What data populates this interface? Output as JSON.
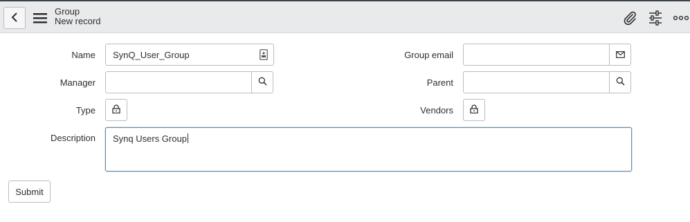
{
  "header": {
    "title": "Group",
    "subtitle": "New record",
    "icons": {
      "back": "chevron-left-icon",
      "menu": "hamburger-menu-icon",
      "attachment": "paperclip-icon",
      "personalize": "sliders-icon",
      "more": "more-options-icon"
    }
  },
  "form": {
    "name": {
      "label": "Name",
      "value": "SynQ_User_Group"
    },
    "group_email": {
      "label": "Group email",
      "value": ""
    },
    "manager": {
      "label": "Manager",
      "value": ""
    },
    "parent": {
      "label": "Parent",
      "value": ""
    },
    "type": {
      "label": "Type"
    },
    "vendors": {
      "label": "Vendors"
    },
    "description": {
      "label": "Description",
      "value": "Synq Users Group"
    }
  },
  "actions": {
    "submit_label": "Submit"
  },
  "colors": {
    "header_bg": "#e9eaeb",
    "top_line": "#3b4148",
    "focus_border": "#4a8fd4",
    "field_border": "#b9bcc0"
  }
}
